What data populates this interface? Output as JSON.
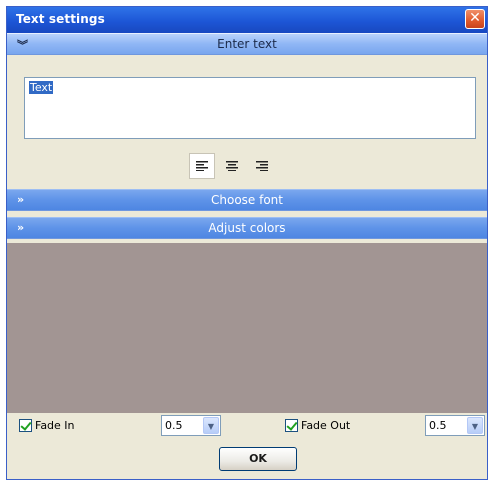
{
  "window": {
    "title": "Text settings",
    "close_icon": "close-icon"
  },
  "sections": {
    "enter_text": {
      "label": "Enter text",
      "chevron": "»",
      "expanded": true
    },
    "choose_font": {
      "label": "Choose font",
      "chevron": "»",
      "expanded": false
    },
    "adjust_colors": {
      "label": "Adjust colors",
      "chevron": "»",
      "expanded": false
    }
  },
  "text_input": {
    "value": "Text"
  },
  "alignment": {
    "options": [
      "align-left-icon",
      "align-center-icon",
      "align-right-icon"
    ],
    "selected": "align-left-icon"
  },
  "fade_in": {
    "label": "Fade In",
    "checked": true,
    "value": "0.5"
  },
  "fade_out": {
    "label": "Fade Out",
    "checked": true,
    "value": "0.5"
  },
  "ok_button": {
    "label": "OK"
  },
  "colors": {
    "title_bar": "#1d56d6",
    "section_header": "#a6c5f6",
    "panel_background": "#ece9d8",
    "color_area": "#a29593"
  }
}
